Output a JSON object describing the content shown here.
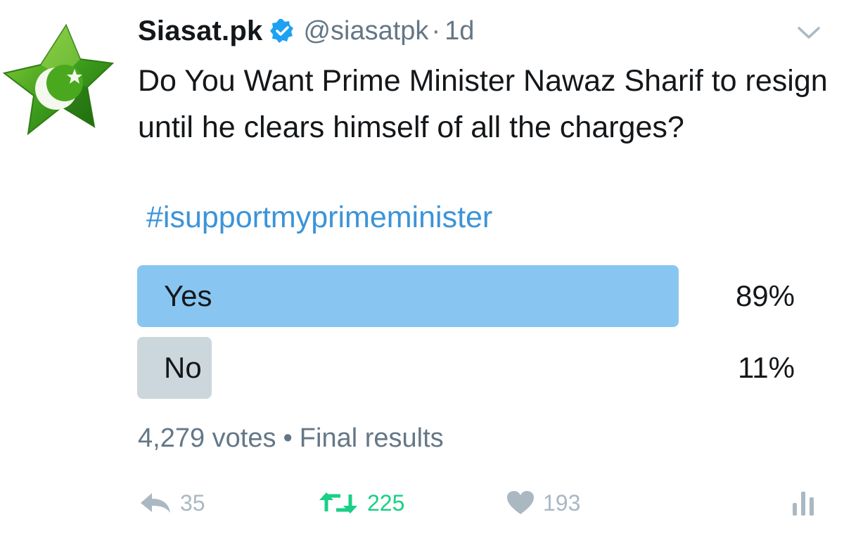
{
  "tweet": {
    "display_name": "Siasat.pk",
    "handle": "@siasatpk",
    "separator": "·",
    "timestamp": "1d",
    "text": "Do You Want Prime Minister Nawaz Sharif to resign until he clears himself of all the charges?",
    "hashtag": "#isupportmyprimeminister"
  },
  "poll": {
    "options": [
      {
        "label": "Yes",
        "percent_text": "89%",
        "fraction": 0.89,
        "bar_color": "#88c6f1"
      },
      {
        "label": "No",
        "percent_text": "11%",
        "fraction": 0.11,
        "bar_color": "#ccd6dd"
      }
    ],
    "votes": "4,279 votes",
    "separator": "•",
    "status": "Final results"
  },
  "actions": {
    "reply_icon": "reply-icon",
    "reply_count": "35",
    "retweet_icon": "retweet-icon",
    "retweet_count": "225",
    "retweet_color": "#19cf86",
    "like_icon": "heart-icon",
    "like_count": "193",
    "analytics_icon": "analytics-icon"
  },
  "colors": {
    "text": "#14171a",
    "secondary": "#657786",
    "link": "#3b94d9",
    "verified": "#1da1f2",
    "icon_gray": "#aab8c2"
  }
}
